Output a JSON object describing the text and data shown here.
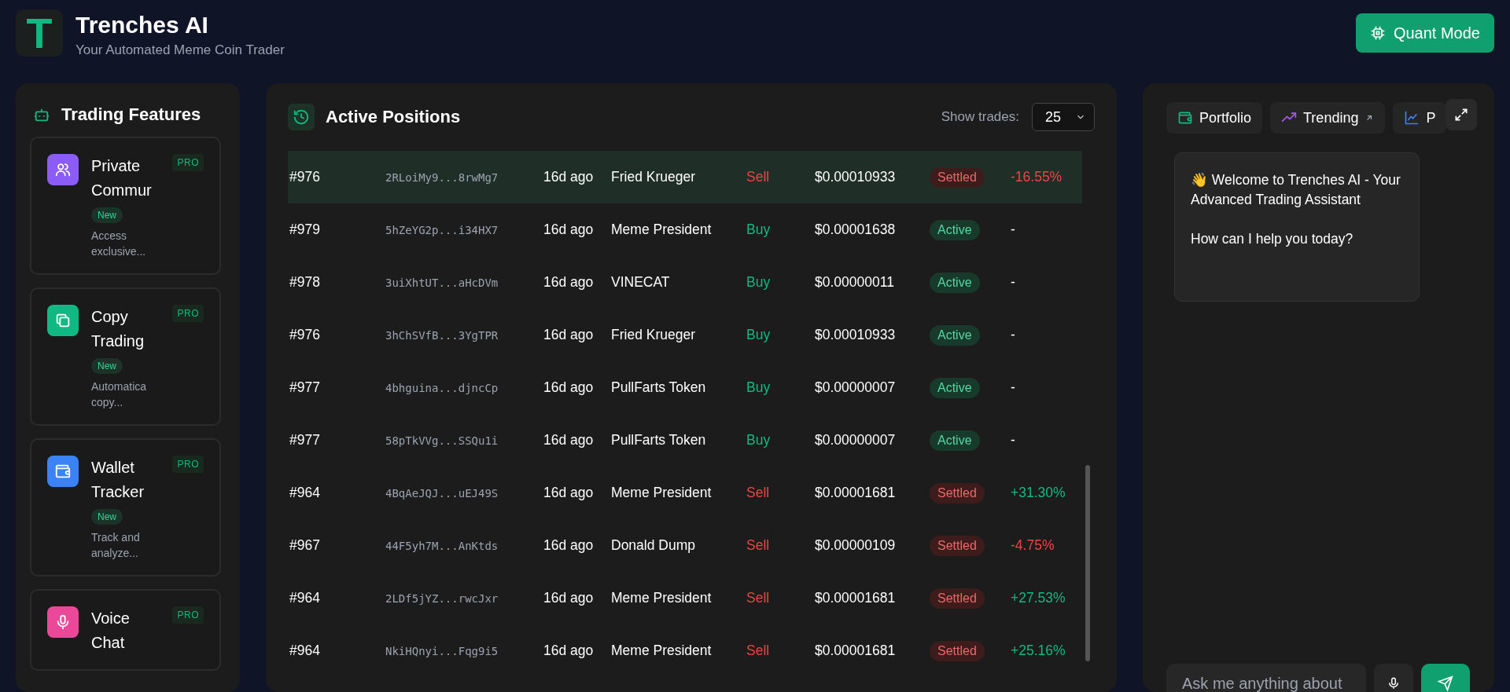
{
  "header": {
    "logo_letter": "T",
    "title": "Trenches AI",
    "subtitle": "Your Automated Meme Coin Trader",
    "quant_button": "Quant Mode"
  },
  "sidebar": {
    "title": "Trading Features",
    "features": [
      {
        "kind": "people",
        "color": "#8b5cf6",
        "title": "Private Commur",
        "tier": "PRO",
        "badge": "New",
        "description": "Access exclusive..."
      },
      {
        "kind": "copy",
        "color": "#10b981",
        "title": "Copy Trading",
        "tier": "PRO",
        "badge": "New",
        "description": "Automatica copy..."
      },
      {
        "kind": "wallet",
        "color": "#3b82f6",
        "title": "Wallet Tracker",
        "tier": "PRO",
        "badge": "New",
        "description": "Track and analyze..."
      },
      {
        "kind": "mic",
        "color": "#ec4899",
        "title": "Voice Chat",
        "tier": "PRO"
      }
    ]
  },
  "positions": {
    "title": "Active Positions",
    "show_label": "Show trades:",
    "show_value": "25",
    "rows": [
      {
        "selected": true,
        "id": "#976",
        "address": "2RLoiMy9...8rwMg7",
        "age": "16d ago",
        "token": "Fried Krueger",
        "side": {
          "text": "Sell",
          "color": "#ef4444"
        },
        "price": "$0.00010933",
        "status": {
          "text": "Settled",
          "color": "#3f1c1c"
        },
        "pnl": {
          "text": "-16.55%",
          "color": "#ef4444"
        }
      },
      {
        "selected": false,
        "id": "#979",
        "address": "5hZeYG2p...i34HX7",
        "age": "16d ago",
        "token": "Meme President",
        "side": {
          "text": "Buy",
          "color": "#10b981"
        },
        "price": "$0.00001638",
        "status": {
          "text": "Active",
          "color": "#173a2c"
        },
        "pnl": {
          "text": "-",
          "color": "#ffffff"
        }
      },
      {
        "selected": false,
        "id": "#978",
        "address": "3uiXhtUT...aHcDVm",
        "age": "16d ago",
        "token": "VINECAT",
        "side": {
          "text": "Buy",
          "color": "#10b981"
        },
        "price": "$0.00000011",
        "status": {
          "text": "Active",
          "color": "#173a2c"
        },
        "pnl": {
          "text": "-",
          "color": "#ffffff"
        }
      },
      {
        "selected": false,
        "id": "#976",
        "address": "3hChSVfB...3YgTPR",
        "age": "16d ago",
        "token": "Fried Krueger",
        "side": {
          "text": "Buy",
          "color": "#10b981"
        },
        "price": "$0.00010933",
        "status": {
          "text": "Active",
          "color": "#173a2c"
        },
        "pnl": {
          "text": "-",
          "color": "#ffffff"
        }
      },
      {
        "selected": false,
        "id": "#977",
        "address": "4bhguina...djncCp",
        "age": "16d ago",
        "token": "PullFarts Token",
        "side": {
          "text": "Buy",
          "color": "#10b981"
        },
        "price": "$0.00000007",
        "status": {
          "text": "Active",
          "color": "#173a2c"
        },
        "pnl": {
          "text": "-",
          "color": "#ffffff"
        }
      },
      {
        "selected": false,
        "id": "#977",
        "address": "58pTkVVg...SSQu1i",
        "age": "16d ago",
        "token": "PullFarts Token",
        "side": {
          "text": "Buy",
          "color": "#10b981"
        },
        "price": "$0.00000007",
        "status": {
          "text": "Active",
          "color": "#173a2c"
        },
        "pnl": {
          "text": "-",
          "color": "#ffffff"
        }
      },
      {
        "selected": false,
        "id": "#964",
        "address": "4BqAeJQJ...uEJ49S",
        "age": "16d ago",
        "token": "Meme President",
        "side": {
          "text": "Sell",
          "color": "#ef4444"
        },
        "price": "$0.00001681",
        "status": {
          "text": "Settled",
          "color": "#3f1c1c"
        },
        "pnl": {
          "text": "+31.30%",
          "color": "#10b981"
        }
      },
      {
        "selected": false,
        "id": "#967",
        "address": "44F5yh7M...AnKtds",
        "age": "16d ago",
        "token": "Donald Dump",
        "side": {
          "text": "Sell",
          "color": "#ef4444"
        },
        "price": "$0.00000109",
        "status": {
          "text": "Settled",
          "color": "#3f1c1c"
        },
        "pnl": {
          "text": "-4.75%",
          "color": "#ef4444"
        }
      },
      {
        "selected": false,
        "id": "#964",
        "address": "2LDf5jYZ...rwcJxr",
        "age": "16d ago",
        "token": "Meme President",
        "side": {
          "text": "Sell",
          "color": "#ef4444"
        },
        "price": "$0.00001681",
        "status": {
          "text": "Settled",
          "color": "#3f1c1c"
        },
        "pnl": {
          "text": "+27.53%",
          "color": "#10b981"
        }
      },
      {
        "selected": false,
        "id": "#964",
        "address": "NkiHQnyi...Fqg9i5",
        "age": "16d ago",
        "token": "Meme President",
        "side": {
          "text": "Sell",
          "color": "#ef4444"
        },
        "price": "$0.00001681",
        "status": {
          "text": "Settled",
          "color": "#3f1c1c"
        },
        "pnl": {
          "text": "+25.16%",
          "color": "#10b981"
        }
      }
    ]
  },
  "chat": {
    "tabs": [
      {
        "kind": "wallet",
        "color": "#10b981",
        "label": "Portfolio",
        "external": false
      },
      {
        "kind": "trend",
        "color": "#a855f7",
        "label": "Trending",
        "external": true
      },
      {
        "kind": "chart",
        "color": "#3b82f6",
        "label": "P",
        "external": false
      }
    ],
    "messages": [
      {
        "text": "👋 Welcome to Trenches AI - Your Advanced Trading Assistant\n\nHow can I help you today?"
      }
    ],
    "input": {
      "placeholder": "Ask me anything about"
    }
  }
}
